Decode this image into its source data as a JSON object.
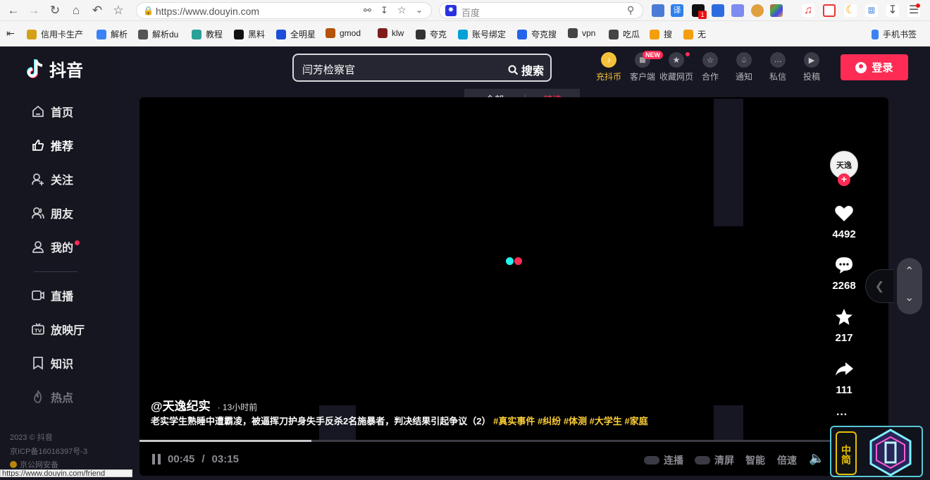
{
  "browser": {
    "url": "https://www.douyin.com",
    "search_engine": "百度",
    "bookmarks": [
      {
        "label": "信用卡生产",
        "color": "#d4a017"
      },
      {
        "label": "解析",
        "color": "#3b82f6"
      },
      {
        "label": "解析du",
        "color": "#555555"
      },
      {
        "label": "教程",
        "color": "#2aa198"
      },
      {
        "label": "黑料",
        "color": "#111111"
      },
      {
        "label": "全明星",
        "color": "#1d4ed8"
      },
      {
        "label": "gmod",
        "color": "#b45309"
      },
      {
        "label": "klw",
        "color": "#7f1d1d"
      },
      {
        "label": "夸克",
        "color": "#333333"
      },
      {
        "label": "账号绑定",
        "color": "#00a1d6"
      },
      {
        "label": "夸克搜",
        "color": "#2563eb"
      },
      {
        "label": "vpn",
        "color": "#444444"
      },
      {
        "label": "吃瓜",
        "color": "#444444"
      },
      {
        "label": "搜",
        "color": "#f59e0b"
      },
      {
        "label": "无",
        "color": "#f59e0b"
      }
    ],
    "mobile_bookmarks": "手机书签",
    "ext_badge": "1",
    "status_url": "https://www.douyin.com/friend"
  },
  "app": {
    "logo_text": "抖音",
    "search_value": "闫芳检察官",
    "search_button": "搜索",
    "search_tabs": [
      "全部",
      "精选"
    ],
    "top_icons": [
      "充抖币",
      "客户端",
      "收藏网页",
      "合作",
      "通知",
      "私信",
      "投稿"
    ],
    "new_badge": "NEW",
    "login": "登录"
  },
  "sidebar": {
    "items": [
      "首页",
      "推荐",
      "关注",
      "朋友",
      "我的",
      "直播",
      "放映厅",
      "知识",
      "热点"
    ],
    "footer": [
      "2023 © 抖音",
      "京ICP备16016397号-3",
      "京公网安备"
    ]
  },
  "video": {
    "author": "@天逸纪实",
    "time_ago": "· 13小时前",
    "desc": "老实学生熟睡中遭霸凌，被逼挥刀护身失手反杀2名施暴者，判决结果引起争议（2）",
    "tags": [
      "#真实事件",
      "#纠纷",
      "#体测",
      "#大学生",
      "#家庭"
    ],
    "likes": "4492",
    "comments": "2268",
    "favorites": "217",
    "shares": "111",
    "more": "···",
    "time_current": "00:45",
    "time_total": "03:15",
    "progress": 0.23,
    "controls": [
      "连播",
      "清屏",
      "智能",
      "倍速"
    ],
    "avatar_text": "天逸",
    "colors": {
      "accent": "#fe2c55",
      "tag": "#facd38",
      "cyan": "#25f4ee"
    }
  },
  "widget": {
    "label": "中简"
  }
}
